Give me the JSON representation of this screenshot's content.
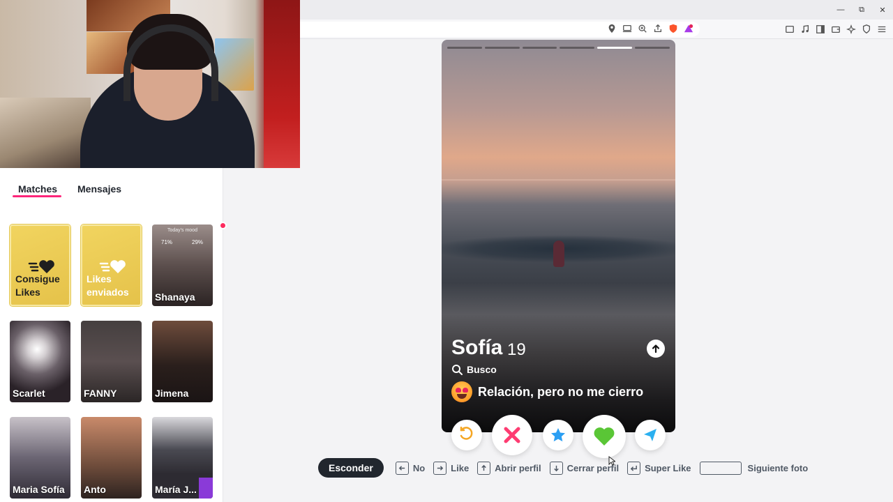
{
  "browser": {
    "window_controls": [
      "—",
      "⧉",
      "✕"
    ]
  },
  "sidebar": {
    "tabs": [
      {
        "label": "Matches",
        "active": true
      },
      {
        "label": "Mensajes",
        "active": false
      }
    ],
    "gold_cards": [
      {
        "label": "Consigue Likes"
      },
      {
        "label": "Likes enviados"
      }
    ],
    "mood_card": {
      "caption": "Today's mood",
      "left": "71%",
      "right": "29%"
    },
    "matches": [
      {
        "name": "Shanaya",
        "has_badge": true
      },
      {
        "name": "Scarlet"
      },
      {
        "name": "FANNY"
      },
      {
        "name": "Jimena"
      },
      {
        "name": "Maria Sofía"
      },
      {
        "name": "Anto"
      },
      {
        "name": "María J..."
      }
    ],
    "accent_color": "#fd267a"
  },
  "profile": {
    "name": "Sofía",
    "age": "19",
    "looking_for_label": "Busco",
    "relationship_goal": "Relación, pero no me cierro",
    "photo_count": 6,
    "active_photo_index": 5
  },
  "actions": [
    {
      "name": "rewind",
      "color": "#f5a623"
    },
    {
      "name": "nope",
      "color": "#fe3c72"
    },
    {
      "name": "super-like",
      "color": "#2b9ff3"
    },
    {
      "name": "like",
      "color": "#5ac636"
    },
    {
      "name": "boost",
      "color": "#2bb0f0"
    }
  ],
  "shortcuts": {
    "hide_label": "Esconder",
    "no": "No",
    "like": "Like",
    "open_profile": "Abrir perfil",
    "close_profile": "Cerrar perfil",
    "super_like": "Super Like",
    "next_photo": "Siguiente foto"
  }
}
